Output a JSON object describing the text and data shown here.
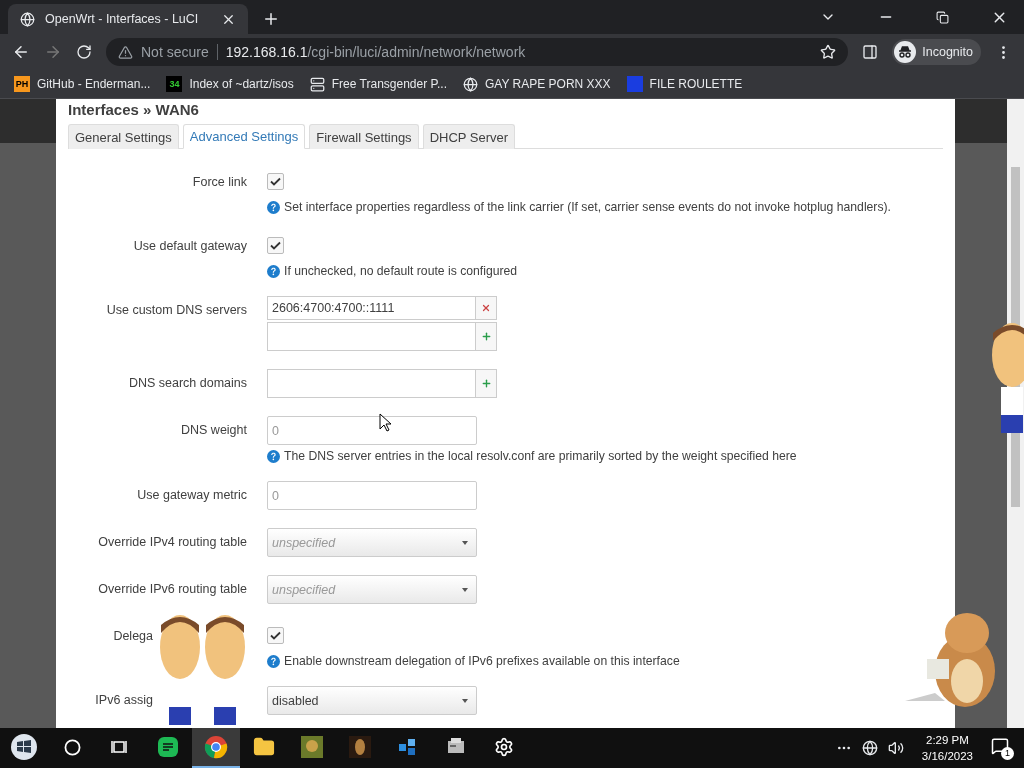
{
  "browser": {
    "tab": {
      "title": "OpenWrt - Interfaces - LuCI",
      "selected": true
    },
    "security": "Not secure",
    "url": {
      "host": "192.168.16.1",
      "path": "/cgi-bin/luci/admin/network/network"
    },
    "profile": "Incognito",
    "bookmarks": [
      {
        "label": "GitHub - Enderman...",
        "icon": {
          "kind": "ph",
          "text": "PH"
        }
      },
      {
        "label": "Index of ~dartz/isos",
        "icon": {
          "kind": "num",
          "text": "34"
        }
      },
      {
        "label": "Free Transgender P...",
        "icon": {
          "kind": "server"
        }
      },
      {
        "label": "GAY RAPE PORN XXX",
        "icon": {
          "kind": "globe"
        }
      },
      {
        "label": "FILE ROULETTE",
        "icon": {
          "kind": "mf"
        }
      }
    ]
  },
  "dialog": {
    "title": "Interfaces » WAN6",
    "tabs": [
      {
        "label": "General Settings",
        "selected": false
      },
      {
        "label": "Advanced Settings",
        "selected": true
      },
      {
        "label": "Firewall Settings",
        "selected": false
      },
      {
        "label": "DHCP Server",
        "selected": false
      }
    ],
    "fields": [
      {
        "kind": "checkbox",
        "label": "Force link",
        "checked": true,
        "help": "Set interface properties regardless of the link carrier (If set, carrier sense events do not invoke hotplug handlers)."
      },
      {
        "kind": "checkbox",
        "label": "Use default gateway",
        "checked": true,
        "help": "If unchecked, no default route is configured"
      },
      {
        "kind": "dynlist",
        "label": "Use custom DNS servers",
        "values": [
          "2606:4700:4700::1111"
        ]
      },
      {
        "kind": "dynlist",
        "label": "DNS search domains"
      },
      {
        "kind": "text",
        "label": "DNS weight",
        "placeholder": "0",
        "help": "The DNS server entries in the local resolv.conf are primarily sorted by the weight specified here"
      },
      {
        "kind": "text",
        "label": "Use gateway metric",
        "placeholder": "0"
      },
      {
        "kind": "select",
        "label": "Override IPv4 routing table",
        "placeholder": "unspecified"
      },
      {
        "kind": "select",
        "label": "Override IPv6 routing table",
        "placeholder": "unspecified"
      },
      {
        "kind": "checkbox",
        "label": "Delega",
        "checked": true,
        "help": "Enable downstream delegation of IPv6 prefixes available on this interface"
      },
      {
        "kind": "select",
        "label": "IPv6 assig",
        "value": "disabled"
      }
    ]
  },
  "taskbar": {
    "apps": [
      {
        "kind": "search",
        "selected": false
      },
      {
        "kind": "taskview",
        "selected": false
      },
      {
        "kind": "green",
        "selected": false
      },
      {
        "kind": "chrome",
        "selected": true
      },
      {
        "kind": "folder",
        "selected": false
      },
      {
        "kind": "game",
        "selected": false
      },
      {
        "kind": "dark",
        "selected": false
      },
      {
        "kind": "blue",
        "selected": false
      },
      {
        "kind": "server",
        "selected": false
      },
      {
        "kind": "settings",
        "selected": false
      }
    ],
    "time": "2:29 PM",
    "date": "3/16/2023",
    "notifications": "1"
  }
}
